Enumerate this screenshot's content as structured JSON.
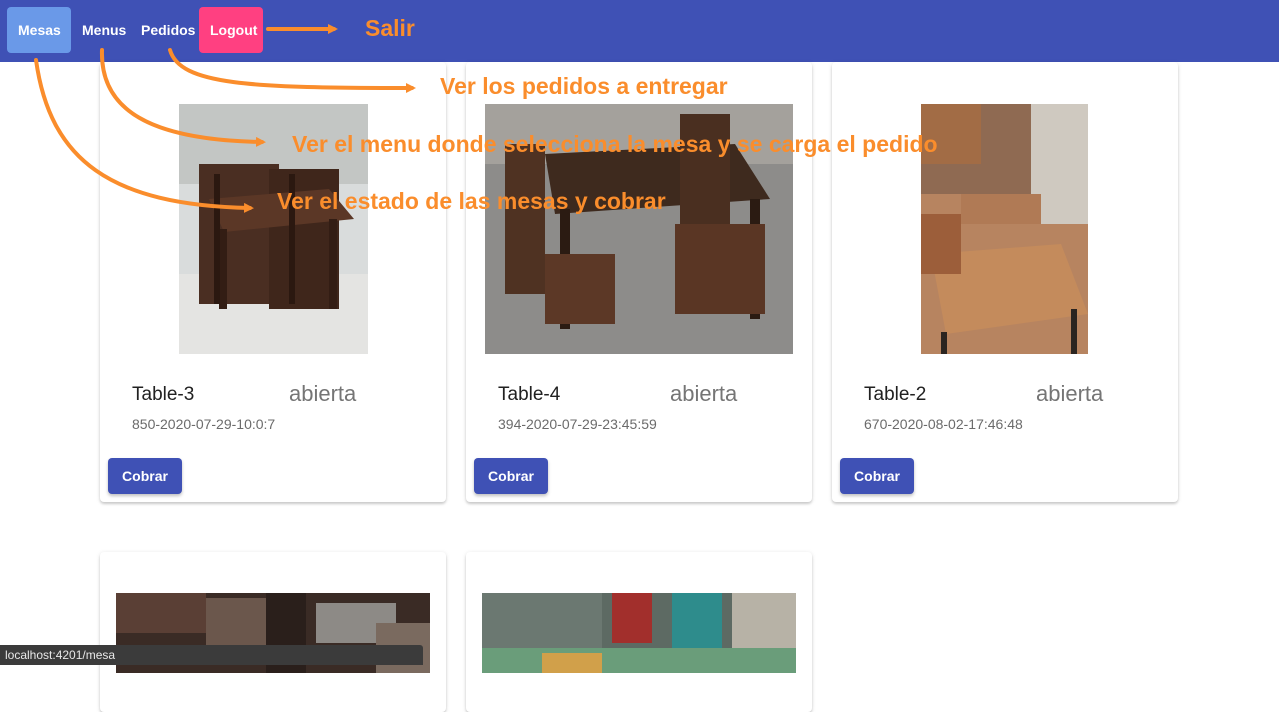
{
  "nav": {
    "items": [
      {
        "label": "Mesas"
      },
      {
        "label": "Menus"
      },
      {
        "label": "Pedidos"
      },
      {
        "label": "Logout"
      }
    ]
  },
  "cards": [
    {
      "title": "Table-3",
      "status": "abierta",
      "subtitle": "850-2020-07-29-10:0:7",
      "button": "Cobrar"
    },
    {
      "title": "Table-4",
      "status": "abierta",
      "subtitle": "394-2020-07-29-23:45:59",
      "button": "Cobrar"
    },
    {
      "title": "Table-2",
      "status": "abierta",
      "subtitle": "670-2020-08-02-17:46:48",
      "button": "Cobrar"
    }
  ],
  "annotations": {
    "salir": "Salir",
    "pedidos": "Ver los pedidos a entregar",
    "menus": "Ver el menu donde selecciona la mesa y se carga el pedido",
    "mesas": "Ver el estado de las mesas y cobrar",
    "color": "#fa8d2c"
  },
  "statusbar": {
    "url": "localhost:4201/mesa"
  },
  "colors": {
    "primary": "#3f51b5",
    "active_nav": "#6a99e8",
    "logout": "#ff4081"
  }
}
